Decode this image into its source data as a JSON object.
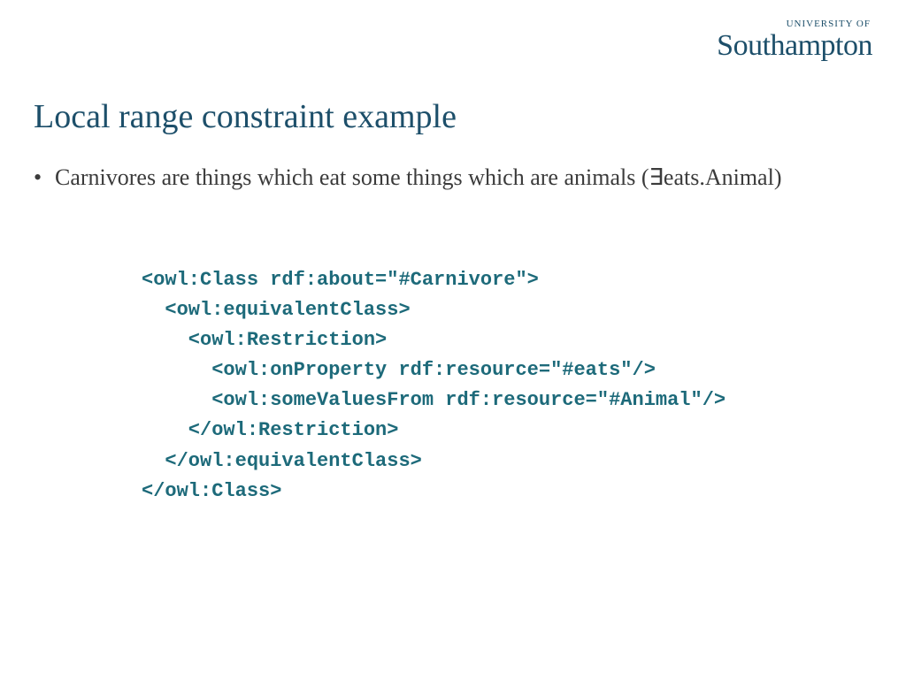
{
  "logo": {
    "top": "UNIVERSITY OF",
    "main": "Southampton"
  },
  "title": "Local range constraint example",
  "bullet": {
    "dot": "•",
    "text": "Carnivores are things which eat some things which are animals (∃eats.Animal)"
  },
  "code": {
    "l1": "<owl:Class rdf:about=\"#Carnivore\">",
    "l2": "  <owl:equivalentClass>",
    "l3": "    <owl:Restriction>",
    "l4": "      <owl:onProperty rdf:resource=\"#eats\"/>",
    "l5": "      <owl:someValuesFrom rdf:resource=\"#Animal\"/>",
    "l6": "    </owl:Restriction>",
    "l7": "  </owl:equivalentClass>",
    "l8": "</owl:Class>"
  }
}
